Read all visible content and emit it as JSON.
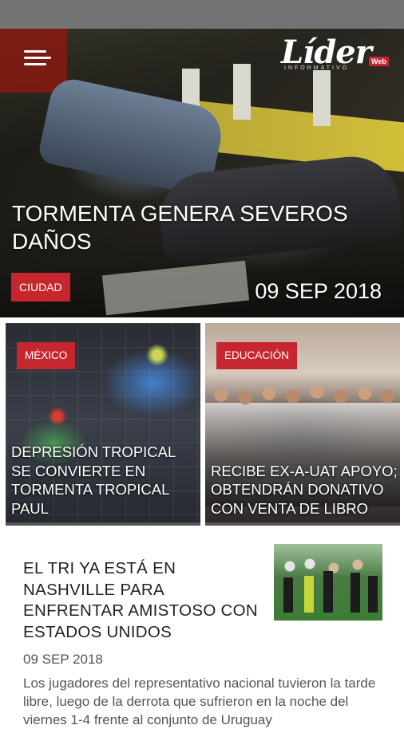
{
  "hero": {
    "brand": "Lider",
    "brand_accent_i": "í",
    "brand_badge": "Web",
    "brand_sub": "INFORMATIVO",
    "title": "TORMENTA GENERA SEVEROS DAÑOS",
    "category": "CIUDAD",
    "date": "09 SEP 2018"
  },
  "cards": [
    {
      "category": "MÉXICO",
      "title": "DEPRESIÓN TROPICAL SE CONVIERTE EN TORMENTA TROPICAL PAUL"
    },
    {
      "category": "EDUCACIÓN",
      "title": "RECIBE EX-A-UAT APOYO; OBTENDRÁN DONATIVO CON VENTA DE LIBRO"
    }
  ],
  "article": {
    "title": "EL TRI YA ESTÁ EN NASHVILLE PARA ENFRENTAR AMISTOSO CON ESTADOS UNIDOS",
    "date": "09 SEP 2018",
    "excerpt": "Los jugadores del representativo nacional tuvieron la tarde libre, luego de la derrota que sufrieron en la noche del viernes 1-4 frente al conjunto de Uruguay"
  },
  "colors": {
    "accent": "#c6262e",
    "statusbar": "#737373"
  },
  "icons": {
    "menu": "hamburger-menu-icon"
  }
}
